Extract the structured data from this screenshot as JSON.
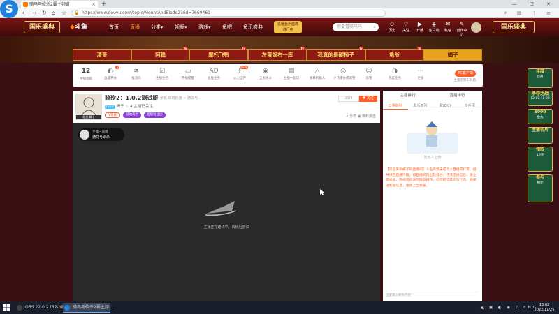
{
  "browser": {
    "logo": "S",
    "tab_title": "骑马与砍杀2霸主频道",
    "url": "https://www.douyu.com/topic/MountAndBlade2?rid=7669461",
    "controls": "— ☐ ✕"
  },
  "header": {
    "logo_left": "国乐盛典",
    "brand": "斗鱼",
    "nav": [
      "首页",
      "直播",
      "分类",
      "视频",
      "游戏",
      "鱼吧",
      "鱼乐盛典"
    ],
    "active_nav": "直播",
    "promo_line1": "星耀鱼乐盛典",
    "promo_line2": "进行中",
    "search_placeholder": "你要看骑马吗",
    "icons": [
      {
        "glyph": "⏲",
        "label": "历史"
      },
      {
        "glyph": "♡",
        "label": "关注"
      },
      {
        "glyph": "▶",
        "label": "开播"
      },
      {
        "glyph": "◈",
        "label": "客户端"
      },
      {
        "glyph": "✉",
        "label": "私信"
      },
      {
        "glyph": "✎",
        "label": "创作中心"
      }
    ],
    "logo_right": "国乐盛典"
  },
  "names": [
    {
      "label": "渣哥",
      "badge": ""
    },
    {
      "label": "阿稳",
      "badge": "lv"
    },
    {
      "label": "摩托飞鸭",
      "badge": "lv"
    },
    {
      "label": "左蛋奴右一库",
      "badge": "lv"
    },
    {
      "label": "我真的是硬柿子",
      "badge": "lv"
    },
    {
      "label": "龟爷",
      "badge": "lv"
    },
    {
      "label": "蝎子",
      "badge": ""
    }
  ],
  "active_name": "蝎子",
  "toolbar": {
    "level": "12",
    "level_label": "主播等级",
    "items": [
      {
        "glyph": "◐",
        "label": "直播开关",
        "badge": "3"
      },
      {
        "glyph": "≋",
        "label": "推流码",
        "badge": ""
      },
      {
        "glyph": "☑",
        "label": "主播任务",
        "badge": ""
      },
      {
        "glyph": "▭",
        "label": "开播提醒",
        "badge": ""
      },
      {
        "glyph": "AD",
        "label": "星推任务",
        "badge": ""
      },
      {
        "glyph": "✈",
        "label": "火力全开",
        "badge": "NEW"
      },
      {
        "glyph": "◉",
        "label": "全民乐斗",
        "badge": ""
      },
      {
        "glyph": "▤",
        "label": "主播一起玩",
        "badge": ""
      },
      {
        "glyph": "△",
        "label": "弹幕机器人",
        "badge": ""
      },
      {
        "glyph": "◎",
        "label": "小飞碟分成调整",
        "badge": ""
      },
      {
        "glyph": "☺",
        "label": "房管",
        "badge": ""
      },
      {
        "glyph": "◑",
        "label": "热度任务",
        "badge": ""
      },
      {
        "glyph": "⋯",
        "label": "更多",
        "badge": ""
      }
    ],
    "pc_button": "PC客户端",
    "pc_sub": "主播定制工具箱"
  },
  "room": {
    "title": "骑砍2：1.0.2测试服",
    "category": "单机  单机热游 > 骑马与...",
    "level": "Lv12",
    "anchor": "蝎子",
    "heat": "♨ 4",
    "report": "主播已关注",
    "tags": [
      "V等级",
      "骑砍高手",
      "超级粉丝团"
    ],
    "follow_count": "3374",
    "follow_label": "♥ 关注",
    "share": "↗ 分享   ▣ 爆料报告",
    "avatar_caption": "粉丝 蝎子",
    "video_title": "主播已离线",
    "video_name": "骑马与砍杀",
    "offline_msg": "主播正在路线中，请稍后尝试"
  },
  "chat": {
    "top_tabs": [
      "主播排行",
      "直播排行"
    ],
    "tabs": [
      "日活前列",
      "周活前列",
      "贵宾(0)",
      "粉丝团"
    ],
    "active_tab": "日活前列",
    "illus_caption": "暂无人上榜",
    "notice": "【欢迎来到蝎子的直播间】斗鱼严禁未成年人直播或打赏。倡导绿色直播环境，如直播间内出现低俗、违法违规信息，请立即举报。网络营销请勿随意跳转，切勿轻信第三方代充、刷单返利等信息，谨防上当受骗。",
    "input_placeholder": "这里输入聊天内容"
  },
  "rail": [
    {
      "line1": "年度",
      "line2": "盛典"
    },
    {
      "line1": "争夺之战",
      "line2": "12:00-18:30"
    },
    {
      "line1": "5000",
      "line2": "鱼丸"
    },
    {
      "line1": "主播名片",
      "line2": ""
    },
    {
      "line1": "领取",
      "line2": "10天"
    },
    {
      "line1": "参与",
      "line2": "抽奖"
    }
  ],
  "taskbar": {
    "tasks": [
      "OBS 22.0.2 (32-bit...",
      "骑马与砍杀2霸主频..."
    ],
    "tray": "ENG",
    "time": "13:02",
    "date": "2022/11/25"
  },
  "colors": {
    "accent": "#ff5d23",
    "banner_red": "#8e1a14",
    "gold": "#e9a31f",
    "taskbar": "#1a1f2b"
  }
}
